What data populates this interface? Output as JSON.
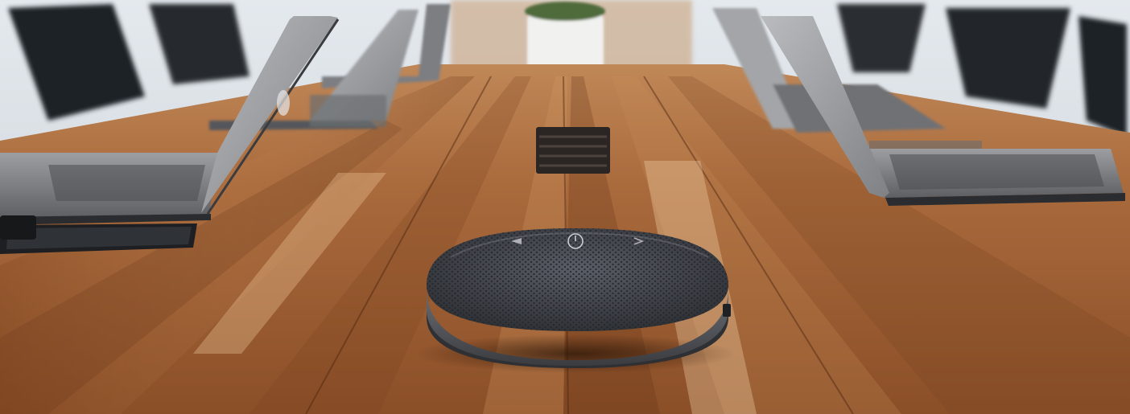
{
  "scene": {
    "subject": "conference-speakerphone",
    "setting": "conference-room-table",
    "objects": [
      "wooden-conference-table",
      "laptop-left-front",
      "laptop-left-middle",
      "laptop-left-back",
      "laptop-right-front",
      "laptop-right-back",
      "smartphone",
      "cable-grommet",
      "plant-pot",
      "office-chairs"
    ]
  },
  "colors": {
    "wood_light": "#b8794a",
    "wood_dark": "#6b3a1c",
    "speaker_fabric": "#3d4046",
    "speaker_base": "#55585e",
    "laptop_silver": "#a9abae",
    "laptop_dark": "#3a3c40",
    "chair_black": "#1f2226",
    "window_light": "#dfe6ec"
  }
}
